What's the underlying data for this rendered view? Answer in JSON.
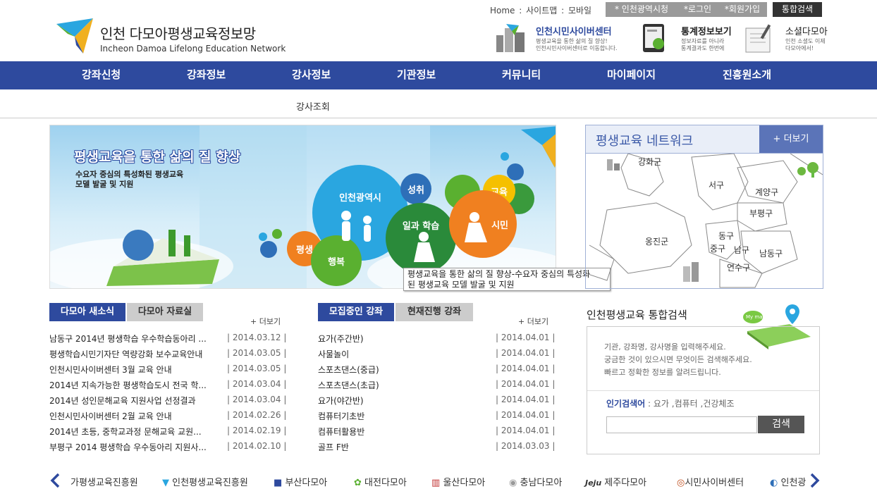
{
  "header": {
    "logo_ko": "인천 다모아평생교육정보망",
    "logo_en": "Incheon Damoa Lifelong Education Network",
    "util_links": [
      "Home",
      "사이트맵",
      "모바일"
    ],
    "top_buttons": {
      "incheon": "* 인천광역시청",
      "login": "*로그인",
      "join": "*회원가입",
      "search_all": "통합검색"
    },
    "quick": [
      {
        "title": "인천시민사이버센터",
        "desc": [
          "평생교육을 통한 삶의 질 향상!",
          "인천시민사이버센터로 이동합니다."
        ]
      },
      {
        "title": "통계정보보기",
        "desc": [
          "정보자료를 아니라",
          "통계결과도 한번에"
        ]
      },
      {
        "title": "소셜다모아",
        "desc": [
          "인천 소셜도 이제",
          "다모아에서!"
        ]
      }
    ]
  },
  "nav": {
    "items": [
      "강좌신청",
      "강좌정보",
      "강사정보",
      "기관정보",
      "커뮤니티",
      "마이페이지",
      "진흥원소개"
    ],
    "sub_item": "강사조회"
  },
  "banner": {
    "title": "평생교육을 통한 삶의 질 향상",
    "subtitle": [
      "수요자 중심의 특성화된 평생교육",
      "모델 발굴 및 지원"
    ],
    "bubbles": [
      "인천광역시",
      "성취",
      "교육",
      "일과 학습",
      "시민",
      "평생",
      "행복"
    ],
    "tooltip": [
      "평생교육을 통한 삶의 질 향상-수요자 중심의 특성화",
      "된 평생교육 모델 발굴 및 지원"
    ]
  },
  "network": {
    "title": "평생교육 네트워크",
    "more": "+ 더보기",
    "districts": [
      "강화군",
      "서구",
      "계양구",
      "부평구",
      "옹진군",
      "동구",
      "중구",
      "남구",
      "남동구",
      "연수구"
    ]
  },
  "news": {
    "tabs": [
      "다모아 새소식",
      "다모아 자료실"
    ],
    "more": "+ 더보기",
    "items": [
      {
        "title": "남동구 2014년 평생학습 우수학습동아리 ...",
        "date": "| 2014.03.12 |"
      },
      {
        "title": "평생학습시민기자단 역량강화 보수교육안내",
        "date": "| 2014.03.05 |"
      },
      {
        "title": "인천시민사이버센터 3월 교육 안내",
        "date": "| 2014.03.05 |"
      },
      {
        "title": "2014년 지속가능한 평생학습도시 전국 학...",
        "date": "| 2014.03.04 |"
      },
      {
        "title": "2014년 성인문해교육 지원사업 선정결과",
        "date": "| 2014.03.04 |"
      },
      {
        "title": "인천시민사이버센터 2월 교육 안내",
        "date": "| 2014.02.26 |"
      },
      {
        "title": "2014년 초등, 중학교과정 문해교육 교원...",
        "date": "| 2014.02.19 |"
      },
      {
        "title": "부평구 2014 평생학습 우수동아리 지원사...",
        "date": "| 2014.02.10 |"
      }
    ]
  },
  "courses": {
    "tabs": [
      "모집중인 강좌",
      "현재진행 강좌"
    ],
    "more": "+ 더보기",
    "items": [
      {
        "title": "요가(주간반)",
        "date": "| 2014.04.01 |"
      },
      {
        "title": "사물놀이",
        "date": "| 2014.04.01 |"
      },
      {
        "title": "스포츠댄스(중급)",
        "date": "| 2014.04.01 |"
      },
      {
        "title": "스포츠댄스(초급)",
        "date": "| 2014.04.01 |"
      },
      {
        "title": "요가(야간반)",
        "date": "| 2014.04.01 |"
      },
      {
        "title": "컴퓨터기초반",
        "date": "| 2014.04.01 |"
      },
      {
        "title": "컴퓨터활용반",
        "date": "| 2014.04.01 |"
      },
      {
        "title": "골프 F반",
        "date": "| 2014.03.03 |"
      }
    ]
  },
  "search": {
    "title": "인천평생교육 통합검색",
    "desc": [
      "기관, 강좌명, 강사명을 입력해주세요.",
      "궁금한 것이 있으시면 무엇이든 검색해주세요.",
      "빠르고 정확한 정보를 알려드립니다."
    ],
    "popular_label": "인기검색어",
    "popular_terms": " : 요가 ,컴퓨터 ,건강체조",
    "button": "검색",
    "badge": "My map"
  },
  "footer_links": [
    "가평생교육진흥원",
    "인천평생교육진흥원",
    "부산다모아",
    "대전다모아",
    "울산다모아",
    "충남다모아",
    "제주다모아",
    "시민사이버센터",
    "인천광"
  ],
  "colors": {
    "brand_blue": "#2e4a9e",
    "accent_orange": "#f08020",
    "accent_green": "#5ab030"
  }
}
